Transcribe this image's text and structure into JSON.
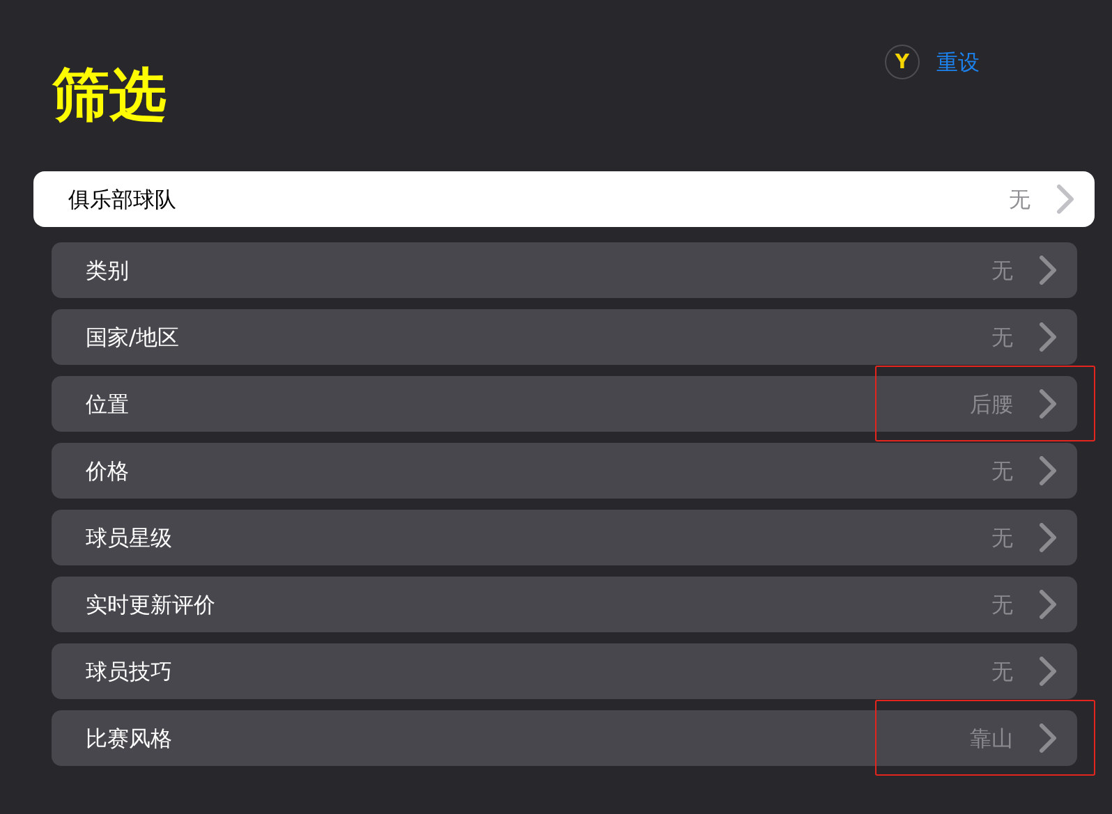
{
  "title": "筛选",
  "reset": {
    "key_hint": "Y",
    "label": "重设"
  },
  "filters": [
    {
      "label": "俱乐部球队",
      "value": "无",
      "selected": true,
      "highlighted": false
    },
    {
      "label": "类别",
      "value": "无",
      "selected": false,
      "highlighted": false
    },
    {
      "label": "国家/地区",
      "value": "无",
      "selected": false,
      "highlighted": false
    },
    {
      "label": "位置",
      "value": "后腰",
      "selected": false,
      "highlighted": true
    },
    {
      "label": "价格",
      "value": "无",
      "selected": false,
      "highlighted": false
    },
    {
      "label": "球员星级",
      "value": "无",
      "selected": false,
      "highlighted": false
    },
    {
      "label": "实时更新评价",
      "value": "无",
      "selected": false,
      "highlighted": false
    },
    {
      "label": "球员技巧",
      "value": "无",
      "selected": false,
      "highlighted": false
    },
    {
      "label": "比赛风格",
      "value": "靠山",
      "selected": false,
      "highlighted": true
    }
  ]
}
